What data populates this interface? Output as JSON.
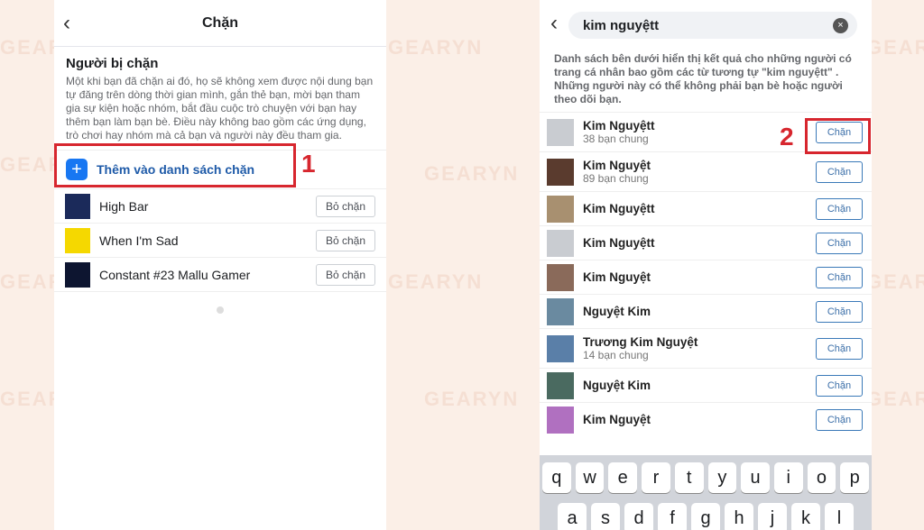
{
  "watermark": "GEARYN",
  "colors": {
    "accent": "#1877f2",
    "highlight": "#d7262e",
    "background": "#fbefe7"
  },
  "left": {
    "title": "Chặn",
    "section_title": "Người bị chặn",
    "description": "Một khi bạn đã chặn ai đó, họ sẽ không xem được nội dung bạn tự đăng trên dòng thời gian mình, gắn thẻ bạn, mời bạn tham gia sự kiện hoặc nhóm, bắt đầu cuộc trò chuyện với bạn hay thêm bạn làm bạn bè. Điều này không bao gồm các ứng dụng, trò chơi hay nhóm mà cả bạn và người này đều tham gia.",
    "add_label": "Thêm vào danh sách chặn",
    "step": "1",
    "blocked": [
      {
        "name": "High Bar",
        "button": "Bỏ chặn",
        "avatar_color": "#1b2a5a"
      },
      {
        "name": "When I'm Sad",
        "button": "Bỏ chặn",
        "avatar_color": "#f5d800"
      },
      {
        "name": "Constant #23 Mallu Gamer",
        "button": "Bỏ chặn",
        "avatar_color": "#0d1530"
      }
    ]
  },
  "right": {
    "search_value": "kim nguyệtt",
    "description": "Danh sách bên dưới hiển thị kết quả cho những người có trang cá nhân bao gồm các từ tương tự \"kim nguyệtt\" . Những người này có thể không phải bạn bè hoặc người theo dõi bạn.",
    "step": "2",
    "results": [
      {
        "name": "Kim Nguyệtt",
        "sub": "38 bạn chung",
        "button": "Chặn",
        "avatar_color": "#c9ccd1"
      },
      {
        "name": "Kim Nguyệt",
        "sub": "89 bạn chung",
        "button": "Chặn",
        "avatar_color": "#5a3b2e"
      },
      {
        "name": "Kim Nguyệtt",
        "button": "Chặn",
        "avatar_color": "#a89070"
      },
      {
        "name": "Kim Nguyệtt",
        "button": "Chặn",
        "avatar_color": "#c9ccd1"
      },
      {
        "name": "Kim Nguyệt",
        "button": "Chặn",
        "avatar_color": "#8a6a5a"
      },
      {
        "name": "Nguyệt Kim",
        "button": "Chặn",
        "avatar_color": "#6a8aa0"
      },
      {
        "name": "Trương Kim Nguyệt",
        "sub": "14 bạn chung",
        "button": "Chặn",
        "avatar_color": "#5a7fa8"
      },
      {
        "name": "Nguyệt Kim",
        "button": "Chặn",
        "avatar_color": "#4a6a60"
      },
      {
        "name": "Kim Nguyệt",
        "button": "Chặn",
        "avatar_color": "#b070c0"
      }
    ],
    "keyboard": [
      [
        "q",
        "w",
        "e",
        "r",
        "t",
        "y",
        "u",
        "i",
        "o",
        "p"
      ],
      [
        "a",
        "s",
        "d",
        "f",
        "g",
        "h",
        "j",
        "k",
        "l"
      ]
    ]
  }
}
